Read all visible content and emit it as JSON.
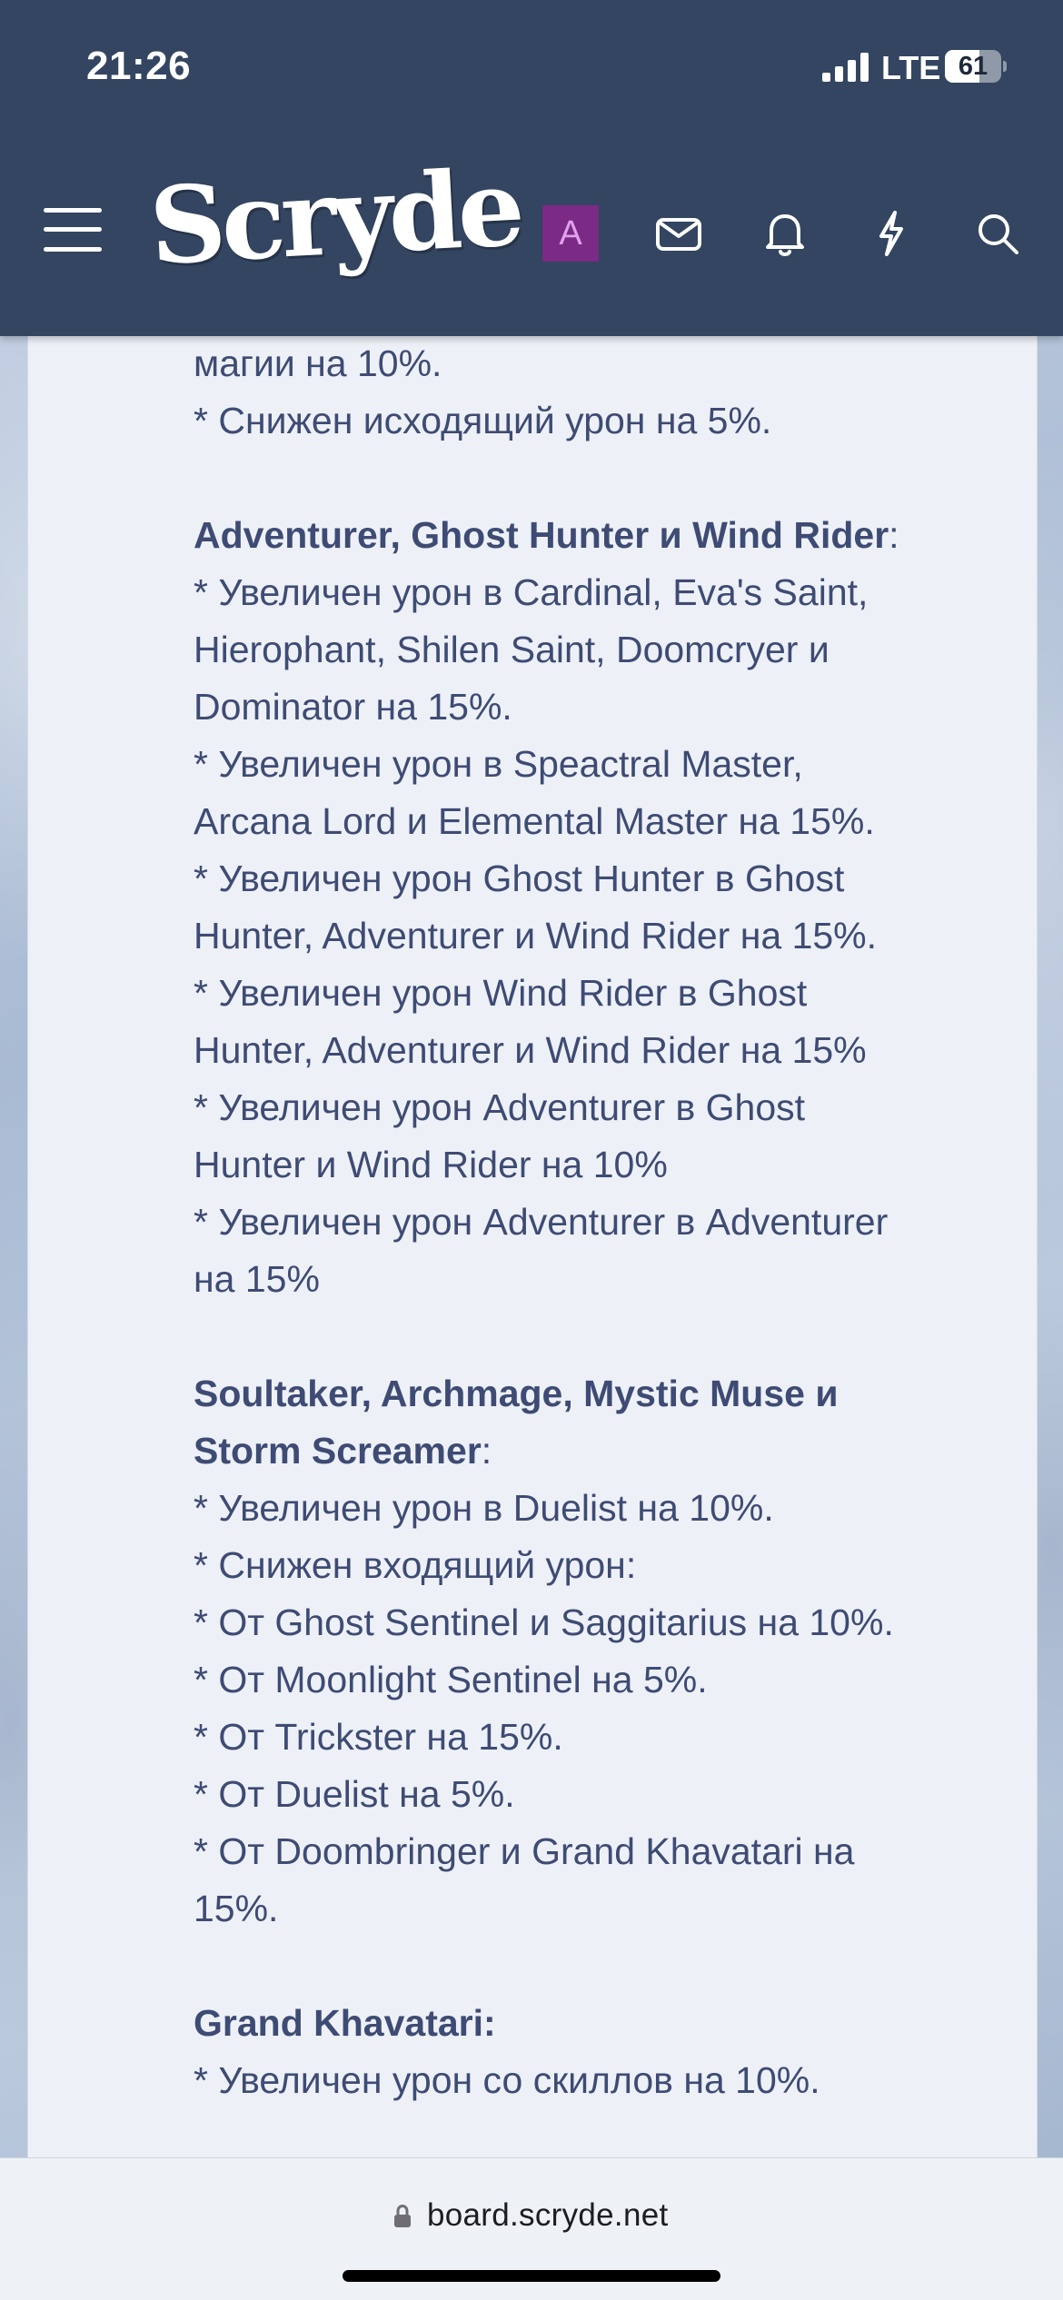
{
  "status_bar": {
    "time": "21:26",
    "network": "LTE",
    "battery": "61",
    "battery_level": 0.61
  },
  "header": {
    "logo": "Scryde",
    "avatar_letter": "A",
    "icons": [
      "menu-icon",
      "envelope-icon",
      "bell-icon",
      "lightning-icon",
      "search-icon"
    ],
    "colors": {
      "background": "#334560",
      "avatar": "#7b2a86"
    }
  },
  "post": {
    "l1": "магии на 10%.",
    "l2": "* Снижен исходящий урон на 5%.",
    "s1_title": "Adventurer, Ghost Hunter и Wind Rider",
    "s1_colon": ":",
    "l3": "* Увеличен урон в Cardinal, Eva's Saint,",
    "l4": "Hierophant, Shilen Saint, Doomcryer и",
    "l5": "Dominator на 15%.",
    "l6": "* Увеличен урон в Speactral Master,",
    "l7": "Arcana Lord и Elemental Master на 15%.",
    "l8": "* Увеличен урон Ghost Hunter в Ghost",
    "l9": "Hunter, Adventurer и Wind Rider на 15%.",
    "l10": "* Увеличен урон Wind Rider в Ghost",
    "l11": "Hunter, Adventurer и Wind Rider на 15%",
    "l12": "* Увеличен урон Adventurer в Ghost",
    "l13": "Hunter и Wind Rider на 10%",
    "l14": "* Увеличен урон Adventurer в Adventurer",
    "l15": "на 15%",
    "s2_title_a": "Soultaker, Archmage, Mystic Muse и",
    "s2_title_b": "Storm Screamer",
    "s2_colon": ":",
    "l16": "* Увеличен урон в Duelist на 10%.",
    "l17": "* Снижен входящий урон:",
    "l18": "* От Ghost Sentinel и Saggitarius на 10%.",
    "l19": "* От Moonlight Sentinel на 5%.",
    "l20": "* От Trickster на 15%.",
    "l21": "* От Duelist на 5%.",
    "l22": "* От Doombringer и Grand Khavatari на",
    "l23": "15%.",
    "s3_title": "Grand Khavatari:",
    "l24": "* Увеличен урон со скиллов на 10%."
  },
  "browser": {
    "url": "board.scryde.net"
  }
}
